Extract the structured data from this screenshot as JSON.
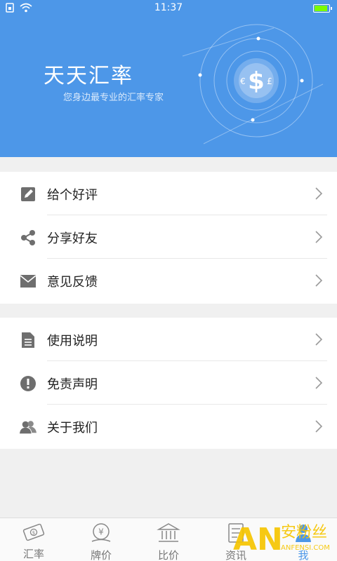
{
  "status_bar": {
    "time": "11:37"
  },
  "header": {
    "title": "天天汇率",
    "subtitle": "您身边最专业的汇率专家"
  },
  "menu_group_1": [
    {
      "label": "给个好评",
      "icon": "edit-icon"
    },
    {
      "label": "分享好友",
      "icon": "share-icon"
    },
    {
      "label": "意见反馈",
      "icon": "mail-icon"
    }
  ],
  "menu_group_2": [
    {
      "label": "使用说明",
      "icon": "document-icon"
    },
    {
      "label": "免责声明",
      "icon": "alert-icon"
    },
    {
      "label": "关于我们",
      "icon": "users-icon"
    }
  ],
  "tabs": [
    {
      "label": "汇率",
      "icon": "money-note-icon"
    },
    {
      "label": "牌价",
      "icon": "yen-coin-icon"
    },
    {
      "label": "比价",
      "icon": "bank-icon"
    },
    {
      "label": "资讯",
      "icon": "news-icon"
    },
    {
      "label": "我",
      "icon": "person-icon"
    }
  ],
  "watermark": {
    "text_main": "AN",
    "text_cn": "安粉丝",
    "text_sub": "ANFENSI.COM"
  },
  "colors": {
    "header_bg": "#4d97e8",
    "tab_active": "#4d97e8",
    "watermark": "#f5c400"
  }
}
